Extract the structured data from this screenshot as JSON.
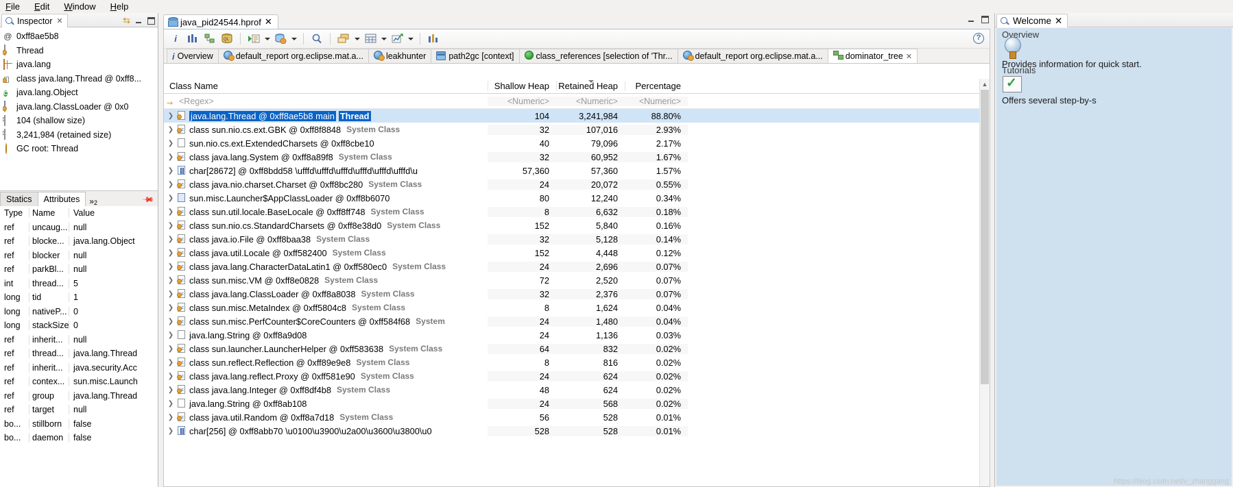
{
  "menubar": {
    "items": [
      "File",
      "Edit",
      "Window",
      "Help"
    ]
  },
  "inspector": {
    "tab_title": "Inspector",
    "close_label": "✕",
    "overview": [
      {
        "icon": "at-icon",
        "label": "@ 0xff8ae5b8"
      },
      {
        "icon": "thread-icon",
        "label": "Thread"
      },
      {
        "icon": "package-icon",
        "label": "java.lang"
      },
      {
        "icon": "class-icon",
        "label": "class java.lang.Thread @ 0xff8..."
      },
      {
        "icon": "superclass-icon",
        "label": "java.lang.Object"
      },
      {
        "icon": "classloader-icon",
        "label": "java.lang.ClassLoader @ 0x0"
      },
      {
        "icon": "size-icon",
        "label": "104 (shallow size)"
      },
      {
        "icon": "size-icon",
        "label": "3,241,984 (retained size)"
      },
      {
        "icon": "gcroot-icon",
        "label": "GC root: Thread"
      }
    ],
    "tabs": [
      {
        "label": "Statics",
        "selected": false
      },
      {
        "label": "Attributes",
        "selected": true
      }
    ],
    "overflow_label": "»",
    "overflow_count": "2",
    "attributes": {
      "columns": [
        "Type",
        "Name",
        "Value"
      ],
      "rows": [
        [
          "ref",
          "uncaug...",
          "null"
        ],
        [
          "ref",
          "blocke...",
          "java.lang.Object"
        ],
        [
          "ref",
          "blocker",
          "null"
        ],
        [
          "ref",
          "parkBl...",
          "null"
        ],
        [
          "int",
          "thread...",
          "5"
        ],
        [
          "long",
          "tid",
          "1"
        ],
        [
          "long",
          "nativeP...",
          "0"
        ],
        [
          "long",
          "stackSize",
          "0"
        ],
        [
          "ref",
          "inherit...",
          "null"
        ],
        [
          "ref",
          "thread...",
          "java.lang.Thread"
        ],
        [
          "ref",
          "inherit...",
          "java.security.Acc"
        ],
        [
          "ref",
          "contex...",
          "sun.misc.Launch"
        ],
        [
          "ref",
          "group",
          "java.lang.Thread"
        ],
        [
          "ref",
          "target",
          "null"
        ],
        [
          "bo...",
          "stillborn",
          "false"
        ],
        [
          "bo...",
          "daemon",
          "false"
        ]
      ]
    }
  },
  "editor": {
    "tab_title": "java_pid24544.hprof",
    "close_label": "✕",
    "toolbar": [
      {
        "name": "heap-dump-info-icon",
        "glyph": "i"
      },
      {
        "name": "histogram-icon",
        "glyph": "bars"
      },
      {
        "name": "dominator-tree-icon",
        "glyph": "tree"
      },
      {
        "name": "oql-icon",
        "glyph": "OQL"
      },
      {
        "name": "run-query-icon",
        "glyph": "run"
      },
      {
        "name": "queries-icon",
        "glyph": "db-gear"
      },
      {
        "name": "search-icon",
        "glyph": "search"
      },
      {
        "name": "group-by-icon",
        "glyph": "group"
      },
      {
        "name": "calculator-icon",
        "glyph": "table"
      },
      {
        "name": "export-icon",
        "glyph": "export"
      },
      {
        "name": "compare-icon",
        "glyph": "compare"
      }
    ],
    "help_label": "?",
    "result_tabs": [
      {
        "label": "Overview",
        "icon": "info-icon",
        "selected": false
      },
      {
        "label": "default_report  org.eclipse.mat.a...",
        "icon": "report-icon",
        "selected": false
      },
      {
        "label": "leakhunter",
        "icon": "report-icon",
        "selected": false
      },
      {
        "label": "path2gc [context]",
        "icon": "path-icon",
        "selected": false
      },
      {
        "label": "class_references [selection of 'Thr...",
        "icon": "green-icon",
        "selected": false
      },
      {
        "label": "default_report  org.eclipse.mat.a...",
        "icon": "report-icon",
        "selected": false
      },
      {
        "label": "dominator_tree",
        "icon": "tree-icon",
        "selected": true
      }
    ],
    "table": {
      "columns": [
        "Class Name",
        "Shallow Heap",
        "Retained Heap",
        "Percentage"
      ],
      "filter_row": [
        "<Regex>",
        "<Numeric>",
        "<Numeric>",
        "<Numeric>"
      ],
      "sorted_column": "Retained Heap",
      "rows": [
        {
          "icon": "instance-icon",
          "name": "java.lang.Thread @ 0xff8ae5b8  main",
          "suffix": "Thread",
          "suffix_kind": "bold",
          "shallow": "104",
          "retained": "3,241,984",
          "pct": "88.80%",
          "selected": true
        },
        {
          "icon": "class-icon",
          "name": "class sun.nio.cs.ext.GBK @ 0xff8f8848",
          "suffix": "System Class",
          "suffix_kind": "system",
          "shallow": "32",
          "retained": "107,016",
          "pct": "2.93%",
          "selected": false
        },
        {
          "icon": "plain-icon",
          "name": "sun.nio.cs.ext.ExtendedCharsets @ 0xff8cbe10",
          "suffix": "",
          "suffix_kind": "",
          "shallow": "40",
          "retained": "79,096",
          "pct": "2.17%",
          "selected": false
        },
        {
          "icon": "class-icon",
          "name": "class java.lang.System @ 0xff8a89f8",
          "suffix": "System Class",
          "suffix_kind": "system",
          "shallow": "32",
          "retained": "60,952",
          "pct": "1.67%",
          "selected": false
        },
        {
          "icon": "array-icon",
          "name": "char[28672] @ 0xff8bdd58  \\ufffd\\ufffd\\ufffd\\ufffd\\ufffd\\ufffd\\u",
          "suffix": "",
          "suffix_kind": "",
          "shallow": "57,360",
          "retained": "57,360",
          "pct": "1.57%",
          "selected": false
        },
        {
          "icon": "class-icon",
          "name": "class java.nio.charset.Charset @ 0xff8bc280",
          "suffix": "System Class",
          "suffix_kind": "system",
          "shallow": "24",
          "retained": "20,072",
          "pct": "0.55%",
          "selected": false
        },
        {
          "icon": "loader-icon",
          "name": "sun.misc.Launcher$AppClassLoader @ 0xff8b6070",
          "suffix": "",
          "suffix_kind": "",
          "shallow": "80",
          "retained": "12,240",
          "pct": "0.34%",
          "selected": false
        },
        {
          "icon": "class-icon",
          "name": "class sun.util.locale.BaseLocale @ 0xff8ff748",
          "suffix": "System Class",
          "suffix_kind": "system",
          "shallow": "8",
          "retained": "6,632",
          "pct": "0.18%",
          "selected": false
        },
        {
          "icon": "class-icon",
          "name": "class sun.nio.cs.StandardCharsets @ 0xff8e38d0",
          "suffix": "System Class",
          "suffix_kind": "system",
          "shallow": "152",
          "retained": "5,840",
          "pct": "0.16%",
          "selected": false
        },
        {
          "icon": "class-icon",
          "name": "class java.io.File @ 0xff8baa38",
          "suffix": "System Class",
          "suffix_kind": "system",
          "shallow": "32",
          "retained": "5,128",
          "pct": "0.14%",
          "selected": false
        },
        {
          "icon": "class-icon",
          "name": "class java.util.Locale @ 0xff582400",
          "suffix": "System Class",
          "suffix_kind": "system",
          "shallow": "152",
          "retained": "4,448",
          "pct": "0.12%",
          "selected": false
        },
        {
          "icon": "class-icon",
          "name": "class java.lang.CharacterDataLatin1 @ 0xff580ec0",
          "suffix": "System Class",
          "suffix_kind": "system",
          "shallow": "24",
          "retained": "2,696",
          "pct": "0.07%",
          "selected": false
        },
        {
          "icon": "class-icon",
          "name": "class sun.misc.VM @ 0xff8e0828",
          "suffix": "System Class",
          "suffix_kind": "system",
          "shallow": "72",
          "retained": "2,520",
          "pct": "0.07%",
          "selected": false
        },
        {
          "icon": "class-icon",
          "name": "class java.lang.ClassLoader @ 0xff8a8038",
          "suffix": "System Class",
          "suffix_kind": "system",
          "shallow": "32",
          "retained": "2,376",
          "pct": "0.07%",
          "selected": false
        },
        {
          "icon": "class-icon",
          "name": "class sun.misc.MetaIndex @ 0xff5804c8",
          "suffix": "System Class",
          "suffix_kind": "system",
          "shallow": "8",
          "retained": "1,624",
          "pct": "0.04%",
          "selected": false
        },
        {
          "icon": "class-icon",
          "name": "class sun.misc.PerfCounter$CoreCounters @ 0xff584f68",
          "suffix": "System",
          "suffix_kind": "system",
          "shallow": "24",
          "retained": "1,480",
          "pct": "0.04%",
          "selected": false
        },
        {
          "icon": "plain-icon",
          "name": "java.lang.String @ 0xff8a9d08",
          "suffix": "",
          "suffix_kind": "",
          "shallow": "24",
          "retained": "1,136",
          "pct": "0.03%",
          "selected": false
        },
        {
          "icon": "class-icon",
          "name": "class sun.launcher.LauncherHelper @ 0xff583638",
          "suffix": "System Class",
          "suffix_kind": "system",
          "shallow": "64",
          "retained": "832",
          "pct": "0.02%",
          "selected": false
        },
        {
          "icon": "class-icon",
          "name": "class sun.reflect.Reflection @ 0xff89e9e8",
          "suffix": "System Class",
          "suffix_kind": "system",
          "shallow": "8",
          "retained": "816",
          "pct": "0.02%",
          "selected": false
        },
        {
          "icon": "class-icon",
          "name": "class java.lang.reflect.Proxy @ 0xff581e90",
          "suffix": "System Class",
          "suffix_kind": "system",
          "shallow": "24",
          "retained": "624",
          "pct": "0.02%",
          "selected": false
        },
        {
          "icon": "class-icon",
          "name": "class java.lang.Integer @ 0xff8df4b8",
          "suffix": "System Class",
          "suffix_kind": "system",
          "shallow": "48",
          "retained": "624",
          "pct": "0.02%",
          "selected": false
        },
        {
          "icon": "plain-icon",
          "name": "java.lang.String @ 0xff8ab108",
          "suffix": "",
          "suffix_kind": "",
          "shallow": "24",
          "retained": "568",
          "pct": "0.02%",
          "selected": false
        },
        {
          "icon": "class-icon",
          "name": "class java.util.Random @ 0xff8a7d18",
          "suffix": "System Class",
          "suffix_kind": "system",
          "shallow": "56",
          "retained": "528",
          "pct": "0.01%",
          "selected": false
        },
        {
          "icon": "array-icon",
          "name": "char[256] @ 0xff8abb70  \\u0100\\u3900\\u2a00\\u3600\\u3800\\u0",
          "suffix": "",
          "suffix_kind": "",
          "shallow": "528",
          "retained": "528",
          "pct": "0.01%",
          "selected": false
        }
      ]
    }
  },
  "welcome": {
    "tab_title": "Welcome",
    "close_label": "✕",
    "sections": [
      {
        "heading": "Overview",
        "icon": "globe-icon",
        "description": "Provides information for quick start."
      },
      {
        "heading": "Tutorials",
        "icon": "tutorial-icon",
        "description": "Offers several step-by-s"
      }
    ]
  },
  "watermark": "https://blog.csdn.net/v_zhanggang"
}
